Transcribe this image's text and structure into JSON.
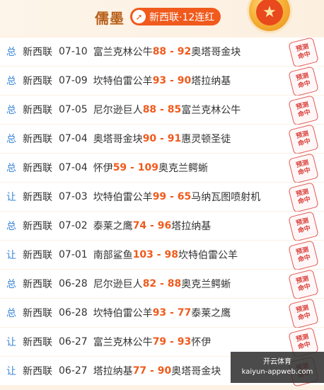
{
  "header": {
    "author": "儒墨",
    "streak_label": "新西联·12连红",
    "streak_icon": "arrow-up-icon"
  },
  "stamp_text": [
    "预测",
    "命中"
  ],
  "rows": [
    {
      "type": "总",
      "league": "新西联",
      "date": "07-10",
      "home": "富兰克林公牛",
      "score": "88 - 92",
      "away": "奥塔哥金块"
    },
    {
      "type": "总",
      "league": "新西联",
      "date": "07-09",
      "home": "坎特伯雷公羊",
      "score": "93 - 90",
      "away": "塔拉纳基"
    },
    {
      "type": "总",
      "league": "新西联",
      "date": "07-05",
      "home": "尼尔逊巨人",
      "score": "88 - 85",
      "away": "富兰克林公牛"
    },
    {
      "type": "总",
      "league": "新西联",
      "date": "07-04",
      "home": "奥塔哥金块",
      "score": "90 - 91",
      "away": "惠灵顿圣徒"
    },
    {
      "type": "总",
      "league": "新西联",
      "date": "07-04",
      "home": "怀伊",
      "score": "59 - 109",
      "away": "奥克兰鳄蜥"
    },
    {
      "type": "让",
      "league": "新西联",
      "date": "07-03",
      "home": "坎特伯雷公羊",
      "score": "99 - 65",
      "away": "马纳瓦图喷射机"
    },
    {
      "type": "总",
      "league": "新西联",
      "date": "07-02",
      "home": "泰莱之鹰",
      "score": "74 - 96",
      "away": "塔拉纳基"
    },
    {
      "type": "让",
      "league": "新西联",
      "date": "07-01",
      "home": "南部鲨鱼",
      "score": "103 - 98",
      "away": "坎特伯雷公羊"
    },
    {
      "type": "总",
      "league": "新西联",
      "date": "06-28",
      "home": "尼尔逊巨人",
      "score": "82 - 88",
      "away": "奥克兰鳄蜥"
    },
    {
      "type": "总",
      "league": "新西联",
      "date": "06-28",
      "home": "坎特伯雷公羊",
      "score": "93 - 77",
      "away": "泰莱之鹰"
    },
    {
      "type": "让",
      "league": "新西联",
      "date": "06-27",
      "home": "富兰克林公牛",
      "score": "79 - 93",
      "away": "怀伊"
    },
    {
      "type": "让",
      "league": "新西联",
      "date": "06-27",
      "home": "塔拉纳基",
      "score": "77 - 90",
      "away": "奥塔哥金块"
    }
  ],
  "watermark": {
    "line1": "开云体育",
    "line2": "kaiyun-appweb.com"
  }
}
